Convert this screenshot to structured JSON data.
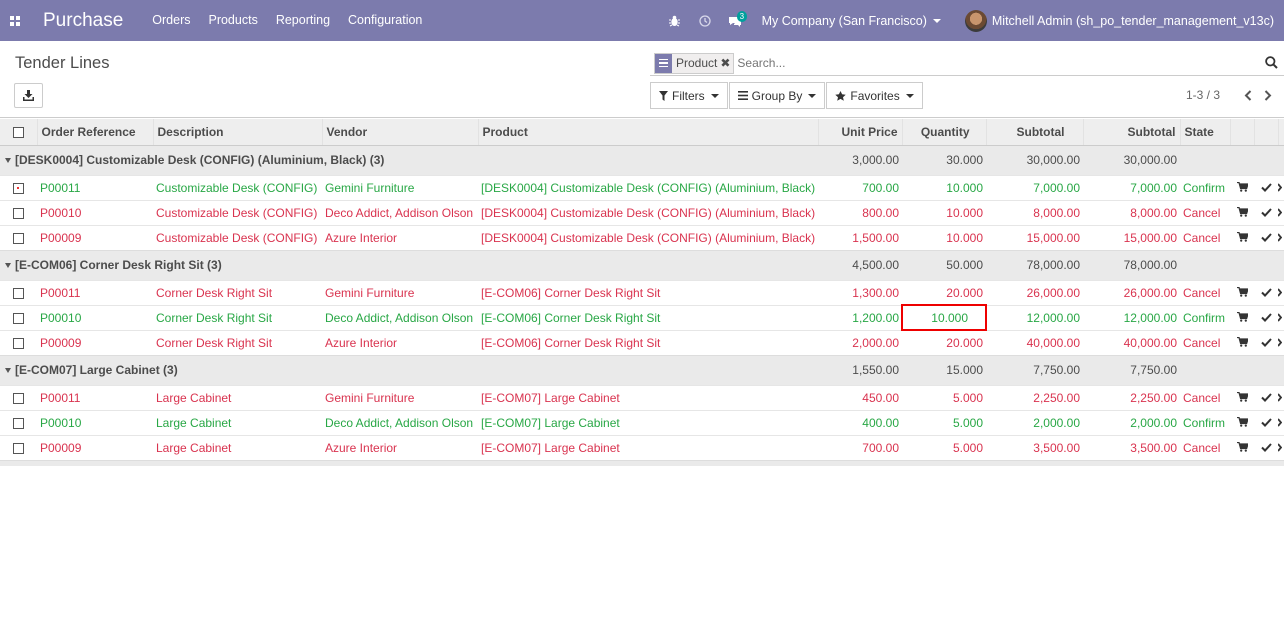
{
  "navbar": {
    "app_title": "Purchase",
    "menu": [
      "Orders",
      "Products",
      "Reporting",
      "Configuration"
    ],
    "messages_count": "3",
    "company": "My Company (San Francisco)",
    "user": "Mitchell Admin (sh_po_tender_management_v13c)",
    "bg_color": "#7c7bad"
  },
  "control_panel": {
    "title": "Tender Lines",
    "search": {
      "facet_value": "Product",
      "placeholder": "Search..."
    },
    "filters_label": "Filters",
    "groupby_label": "Group By",
    "favorites_label": "Favorites",
    "pager_value": "1-3 / 3"
  },
  "table": {
    "headers": {
      "order_ref": "Order Reference",
      "description": "Description",
      "vendor": "Vendor",
      "product": "Product",
      "unit_price": "Unit Price",
      "quantity": "Quantity",
      "subtotal1": "Subtotal",
      "subtotal2": "Subtotal",
      "state": "State"
    },
    "groups": [
      {
        "label": "[DESK0004] Customizable Desk (CONFIG) (Aluminium, Black) (3)",
        "unit_price": "3,000.00",
        "quantity": "30.000",
        "subtotal1": "30,000.00",
        "subtotal2": "30,000.00",
        "rows": [
          {
            "ref": "P00011",
            "desc": "Customizable Desk (CONFIG)",
            "vendor": "Gemini Furniture",
            "product": "[DESK0004] Customizable Desk (CONFIG) (Aluminium, Black)",
            "price": "700.00",
            "qty": "10.000",
            "sub1": "7,000.00",
            "sub2": "7,000.00",
            "state": "Confirm"
          },
          {
            "ref": "P00010",
            "desc": "Customizable Desk (CONFIG)",
            "vendor": "Deco Addict, Addison Olson",
            "product": "[DESK0004] Customizable Desk (CONFIG) (Aluminium, Black)",
            "price": "800.00",
            "qty": "10.000",
            "sub1": "8,000.00",
            "sub2": "8,000.00",
            "state": "Cancel"
          },
          {
            "ref": "P00009",
            "desc": "Customizable Desk (CONFIG)",
            "vendor": "Azure Interior",
            "product": "[DESK0004] Customizable Desk (CONFIG) (Aluminium, Black)",
            "price": "1,500.00",
            "qty": "10.000",
            "sub1": "15,000.00",
            "sub2": "15,000.00",
            "state": "Cancel"
          }
        ]
      },
      {
        "label": "[E-COM06] Corner Desk Right Sit (3)",
        "unit_price": "4,500.00",
        "quantity": "50.000",
        "subtotal1": "78,000.00",
        "subtotal2": "78,000.00",
        "rows": [
          {
            "ref": "P00011",
            "desc": "Corner Desk Right Sit",
            "vendor": "Gemini Furniture",
            "product": "[E-COM06] Corner Desk Right Sit",
            "price": "1,300.00",
            "qty": "20.000",
            "sub1": "26,000.00",
            "sub2": "26,000.00",
            "state": "Cancel"
          },
          {
            "ref": "P00010",
            "desc": "Corner Desk Right Sit",
            "vendor": "Deco Addict, Addison Olson",
            "product": "[E-COM06] Corner Desk Right Sit",
            "price": "1,200.00",
            "qty": "10.000",
            "sub1": "12,000.00",
            "sub2": "12,000.00",
            "state": "Confirm"
          },
          {
            "ref": "P00009",
            "desc": "Corner Desk Right Sit",
            "vendor": "Azure Interior",
            "product": "[E-COM06] Corner Desk Right Sit",
            "price": "2,000.00",
            "qty": "20.000",
            "sub1": "40,000.00",
            "sub2": "40,000.00",
            "state": "Cancel"
          }
        ]
      },
      {
        "label": "[E-COM07] Large Cabinet (3)",
        "unit_price": "1,550.00",
        "quantity": "15.000",
        "subtotal1": "7,750.00",
        "subtotal2": "7,750.00",
        "rows": [
          {
            "ref": "P00011",
            "desc": "Large Cabinet",
            "vendor": "Gemini Furniture",
            "product": "[E-COM07] Large Cabinet",
            "price": "450.00",
            "qty": "5.000",
            "sub1": "2,250.00",
            "sub2": "2,250.00",
            "state": "Cancel"
          },
          {
            "ref": "P00010",
            "desc": "Large Cabinet",
            "vendor": "Deco Addict, Addison Olson",
            "product": "[E-COM07] Large Cabinet",
            "price": "400.00",
            "qty": "5.000",
            "sub1": "2,000.00",
            "sub2": "2,000.00",
            "state": "Confirm"
          },
          {
            "ref": "P00009",
            "desc": "Large Cabinet",
            "vendor": "Azure Interior",
            "product": "[E-COM07] Large Cabinet",
            "price": "700.00",
            "qty": "5.000",
            "sub1": "3,500.00",
            "sub2": "3,500.00",
            "state": "Cancel"
          }
        ]
      }
    ]
  }
}
